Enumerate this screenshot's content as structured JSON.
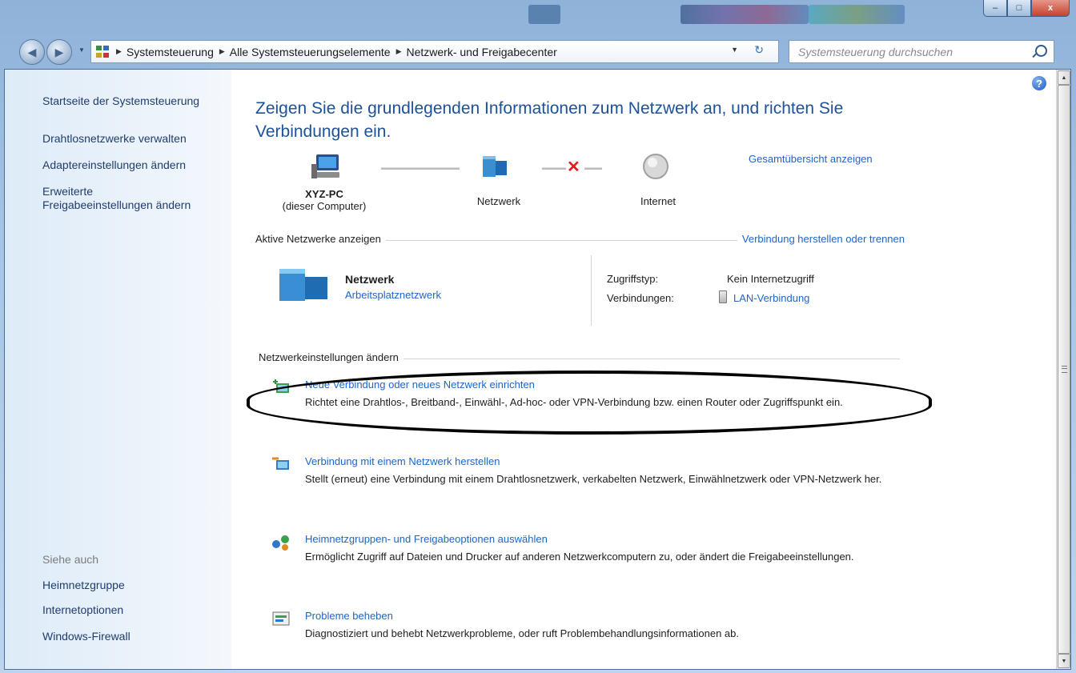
{
  "window": {
    "title_buttons": {
      "minimize": "–",
      "maximize": "□",
      "close": "x"
    }
  },
  "navbar": {
    "back_icon": "back-arrow-icon",
    "forward_icon": "forward-arrow-icon",
    "breadcrumb": [
      "Systemsteuerung",
      "Alle Systemsteuerungselemente",
      "Netzwerk- und Freigabecenter"
    ],
    "search_placeholder": "Systemsteuerung durchsuchen"
  },
  "sidebar": {
    "home": "Startseite der Systemsteuerung",
    "items": [
      {
        "label": "Drahtlosnetzwerke verwalten"
      },
      {
        "label": "Adaptereinstellungen ändern"
      },
      {
        "label": "Erweiterte\nFreigabeeinstellungen ändern"
      }
    ],
    "see_also_title": "Siehe auch",
    "see_also": [
      {
        "label": "Heimnetzgruppe"
      },
      {
        "label": "Internetoptionen"
      },
      {
        "label": "Windows-Firewall"
      }
    ]
  },
  "main": {
    "heading": "Zeigen Sie die grundlegenden Informationen zum Netzwerk an, und richten Sie Verbindungen ein.",
    "overview_link": "Gesamtübersicht anzeigen",
    "nodes": [
      {
        "name": "XYZ-PC",
        "sub": "(dieser Computer)"
      },
      {
        "name": "Netzwerk",
        "sub": ""
      },
      {
        "name": "Internet",
        "sub": ""
      }
    ],
    "active_networks_title": "Aktive Netzwerke anzeigen",
    "connect_link": "Verbindung herstellen oder trennen",
    "network": {
      "name": "Netzwerk",
      "type_link": "Arbeitsplatznetzwerk",
      "access_type_label": "Zugriffstyp:",
      "access_type_value": "Kein Internetzugriff",
      "connections_label": "Verbindungen:",
      "connections_value": "LAN-Verbindung"
    },
    "settings_title": "Netzwerkeinstellungen ändern",
    "tasks": [
      {
        "link": "Neue Verbindung oder neues Netzwerk einrichten",
        "desc": "Richtet eine Drahtlos-, Breitband-, Einwähl-, Ad-hoc- oder VPN-Verbindung bzw. einen Router oder Zugriffspunkt ein.",
        "icon": "new-connection-icon"
      },
      {
        "link": "Verbindung mit einem Netzwerk herstellen",
        "desc": "Stellt (erneut) eine Verbindung mit einem Drahtlosnetzwerk, verkabelten Netzwerk, Einwählnetzwerk oder VPN-Netzwerk her.",
        "icon": "connect-network-icon"
      },
      {
        "link": "Heimnetzgruppen- und Freigabeoptionen auswählen",
        "desc": "Ermöglicht Zugriff auf Dateien und Drucker auf anderen Netzwerkcomputern zu, oder ändert die Freigabeeinstellungen.",
        "icon": "homegroup-icon"
      },
      {
        "link": "Probleme beheben",
        "desc": "Diagnostiziert und behebt Netzwerkprobleme, oder ruft Problembehandlungsinformationen ab.",
        "icon": "troubleshoot-icon"
      }
    ]
  },
  "colors": {
    "link": "#1d66c7",
    "heading": "#1d5198",
    "error_x": "#e02020",
    "annotation": "#000000"
  }
}
